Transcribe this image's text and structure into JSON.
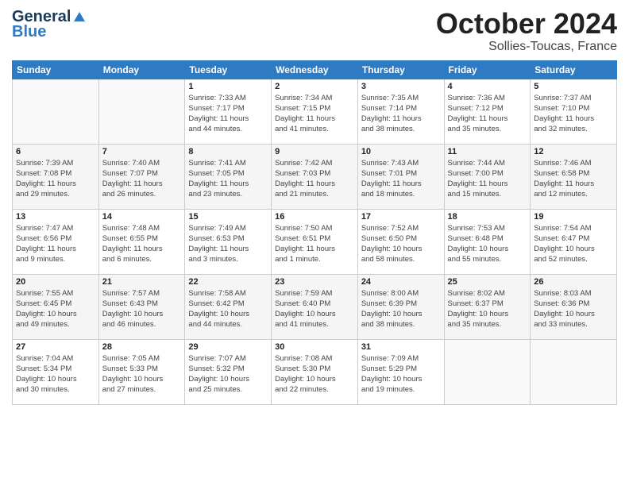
{
  "header": {
    "logo_line1": "General",
    "logo_line2": "Blue",
    "month": "October 2024",
    "location": "Sollies-Toucas, France"
  },
  "weekdays": [
    "Sunday",
    "Monday",
    "Tuesday",
    "Wednesday",
    "Thursday",
    "Friday",
    "Saturday"
  ],
  "weeks": [
    [
      {
        "day": "",
        "info": ""
      },
      {
        "day": "",
        "info": ""
      },
      {
        "day": "1",
        "info": "Sunrise: 7:33 AM\nSunset: 7:17 PM\nDaylight: 11 hours\nand 44 minutes."
      },
      {
        "day": "2",
        "info": "Sunrise: 7:34 AM\nSunset: 7:15 PM\nDaylight: 11 hours\nand 41 minutes."
      },
      {
        "day": "3",
        "info": "Sunrise: 7:35 AM\nSunset: 7:14 PM\nDaylight: 11 hours\nand 38 minutes."
      },
      {
        "day": "4",
        "info": "Sunrise: 7:36 AM\nSunset: 7:12 PM\nDaylight: 11 hours\nand 35 minutes."
      },
      {
        "day": "5",
        "info": "Sunrise: 7:37 AM\nSunset: 7:10 PM\nDaylight: 11 hours\nand 32 minutes."
      }
    ],
    [
      {
        "day": "6",
        "info": "Sunrise: 7:39 AM\nSunset: 7:08 PM\nDaylight: 11 hours\nand 29 minutes."
      },
      {
        "day": "7",
        "info": "Sunrise: 7:40 AM\nSunset: 7:07 PM\nDaylight: 11 hours\nand 26 minutes."
      },
      {
        "day": "8",
        "info": "Sunrise: 7:41 AM\nSunset: 7:05 PM\nDaylight: 11 hours\nand 23 minutes."
      },
      {
        "day": "9",
        "info": "Sunrise: 7:42 AM\nSunset: 7:03 PM\nDaylight: 11 hours\nand 21 minutes."
      },
      {
        "day": "10",
        "info": "Sunrise: 7:43 AM\nSunset: 7:01 PM\nDaylight: 11 hours\nand 18 minutes."
      },
      {
        "day": "11",
        "info": "Sunrise: 7:44 AM\nSunset: 7:00 PM\nDaylight: 11 hours\nand 15 minutes."
      },
      {
        "day": "12",
        "info": "Sunrise: 7:46 AM\nSunset: 6:58 PM\nDaylight: 11 hours\nand 12 minutes."
      }
    ],
    [
      {
        "day": "13",
        "info": "Sunrise: 7:47 AM\nSunset: 6:56 PM\nDaylight: 11 hours\nand 9 minutes."
      },
      {
        "day": "14",
        "info": "Sunrise: 7:48 AM\nSunset: 6:55 PM\nDaylight: 11 hours\nand 6 minutes."
      },
      {
        "day": "15",
        "info": "Sunrise: 7:49 AM\nSunset: 6:53 PM\nDaylight: 11 hours\nand 3 minutes."
      },
      {
        "day": "16",
        "info": "Sunrise: 7:50 AM\nSunset: 6:51 PM\nDaylight: 11 hours\nand 1 minute."
      },
      {
        "day": "17",
        "info": "Sunrise: 7:52 AM\nSunset: 6:50 PM\nDaylight: 10 hours\nand 58 minutes."
      },
      {
        "day": "18",
        "info": "Sunrise: 7:53 AM\nSunset: 6:48 PM\nDaylight: 10 hours\nand 55 minutes."
      },
      {
        "day": "19",
        "info": "Sunrise: 7:54 AM\nSunset: 6:47 PM\nDaylight: 10 hours\nand 52 minutes."
      }
    ],
    [
      {
        "day": "20",
        "info": "Sunrise: 7:55 AM\nSunset: 6:45 PM\nDaylight: 10 hours\nand 49 minutes."
      },
      {
        "day": "21",
        "info": "Sunrise: 7:57 AM\nSunset: 6:43 PM\nDaylight: 10 hours\nand 46 minutes."
      },
      {
        "day": "22",
        "info": "Sunrise: 7:58 AM\nSunset: 6:42 PM\nDaylight: 10 hours\nand 44 minutes."
      },
      {
        "day": "23",
        "info": "Sunrise: 7:59 AM\nSunset: 6:40 PM\nDaylight: 10 hours\nand 41 minutes."
      },
      {
        "day": "24",
        "info": "Sunrise: 8:00 AM\nSunset: 6:39 PM\nDaylight: 10 hours\nand 38 minutes."
      },
      {
        "day": "25",
        "info": "Sunrise: 8:02 AM\nSunset: 6:37 PM\nDaylight: 10 hours\nand 35 minutes."
      },
      {
        "day": "26",
        "info": "Sunrise: 8:03 AM\nSunset: 6:36 PM\nDaylight: 10 hours\nand 33 minutes."
      }
    ],
    [
      {
        "day": "27",
        "info": "Sunrise: 7:04 AM\nSunset: 5:34 PM\nDaylight: 10 hours\nand 30 minutes."
      },
      {
        "day": "28",
        "info": "Sunrise: 7:05 AM\nSunset: 5:33 PM\nDaylight: 10 hours\nand 27 minutes."
      },
      {
        "day": "29",
        "info": "Sunrise: 7:07 AM\nSunset: 5:32 PM\nDaylight: 10 hours\nand 25 minutes."
      },
      {
        "day": "30",
        "info": "Sunrise: 7:08 AM\nSunset: 5:30 PM\nDaylight: 10 hours\nand 22 minutes."
      },
      {
        "day": "31",
        "info": "Sunrise: 7:09 AM\nSunset: 5:29 PM\nDaylight: 10 hours\nand 19 minutes."
      },
      {
        "day": "",
        "info": ""
      },
      {
        "day": "",
        "info": ""
      }
    ]
  ]
}
